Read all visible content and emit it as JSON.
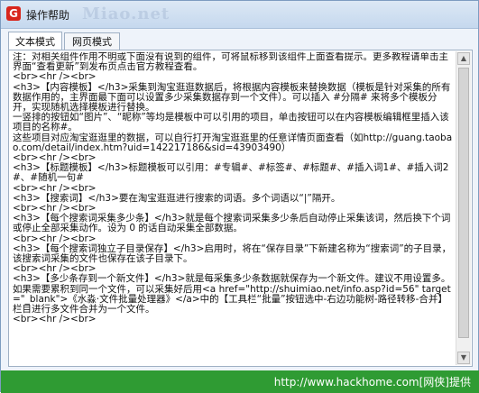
{
  "window": {
    "title": "操作帮助",
    "icon_letter": "G",
    "watermark": "Miao.net"
  },
  "tabs": [
    {
      "label": "文本模式",
      "active": true
    },
    {
      "label": "网页模式",
      "active": false
    }
  ],
  "content": {
    "lines": [
      "注：对相关组件作用不明或下面没有说到的组件，可将鼠标移到该组件上面查看提示。更多教程请单击主界面“查看更新”到发布页点击官方教程查看。",
      "<br><hr /><br>",
      "<h3>【内容模板】</h3>采集到淘宝逛逛数据后，将根据内容模板来替换数据（模板是针对采集的所有数据作用的，主界面最下面可以设置多少采集数据存到一个文件）。可以插入 #分隔# 来将多个模板分开，实现随机选择模板进行替换。",
      "一竖排的按钮如“图片”、“昵称”等均是模板中可以引用的项目，单击按钮可以在内容模板编辑框里插入该项目的名称#。",
      "这些项目对应淘宝逛逛里的数据，可以自行打开淘宝逛逛里的任意详情页面查看（如http://guang.taobao.com/detail/index.htm?uid=142217186&sid=43903490）",
      "<br><hr /><br>",
      "<h3>【标题模板】</h3>标题模板可以引用：#专辑#、#标签#、#标题#、#插入词1#、#插入词2#、#随机一句#",
      "<br><hr /><br>",
      "<h3>【搜索词】</h3>要在淘宝逛逛进行搜索的词语。多个词语以“|”隔开。",
      "<br><hr /><br>",
      "<h3>【每个搜索词采集多少条】</h3>就是每个搜索词采集多少条后自动停止采集该词，然后换下个词或停止全部采集动作。设为 0 的话自动采集全部数据。",
      "<br><hr /><br>",
      "<h3>【每个搜索词独立子目录保存】</h3>启用时，将在“保存目录”下新建名称为“搜索词”的子目录，该搜索词采集的文件也保存在该子目录下。",
      "<br><hr /><br>",
      "<h3>【多少条存到一个新文件】</h3>就是每采集多少条数据就保存为一个新文件。建议不用设置多。如果需要累积到同一个文件，可以采集好后用<a href=\"http://shuimiao.net/info.asp?id=56\" target=\"_blank\">《水淼·文件批量处理器》</a>中的【工具栏“批量”按钮选中-右边功能树-路径转移-合并】栏目进行多文件合并为一个文件。",
      "<br><hr /><br>"
    ]
  },
  "footer": {
    "text": "http://www.hackhome.com[网侠]提供",
    "color": "#2f9b33"
  }
}
